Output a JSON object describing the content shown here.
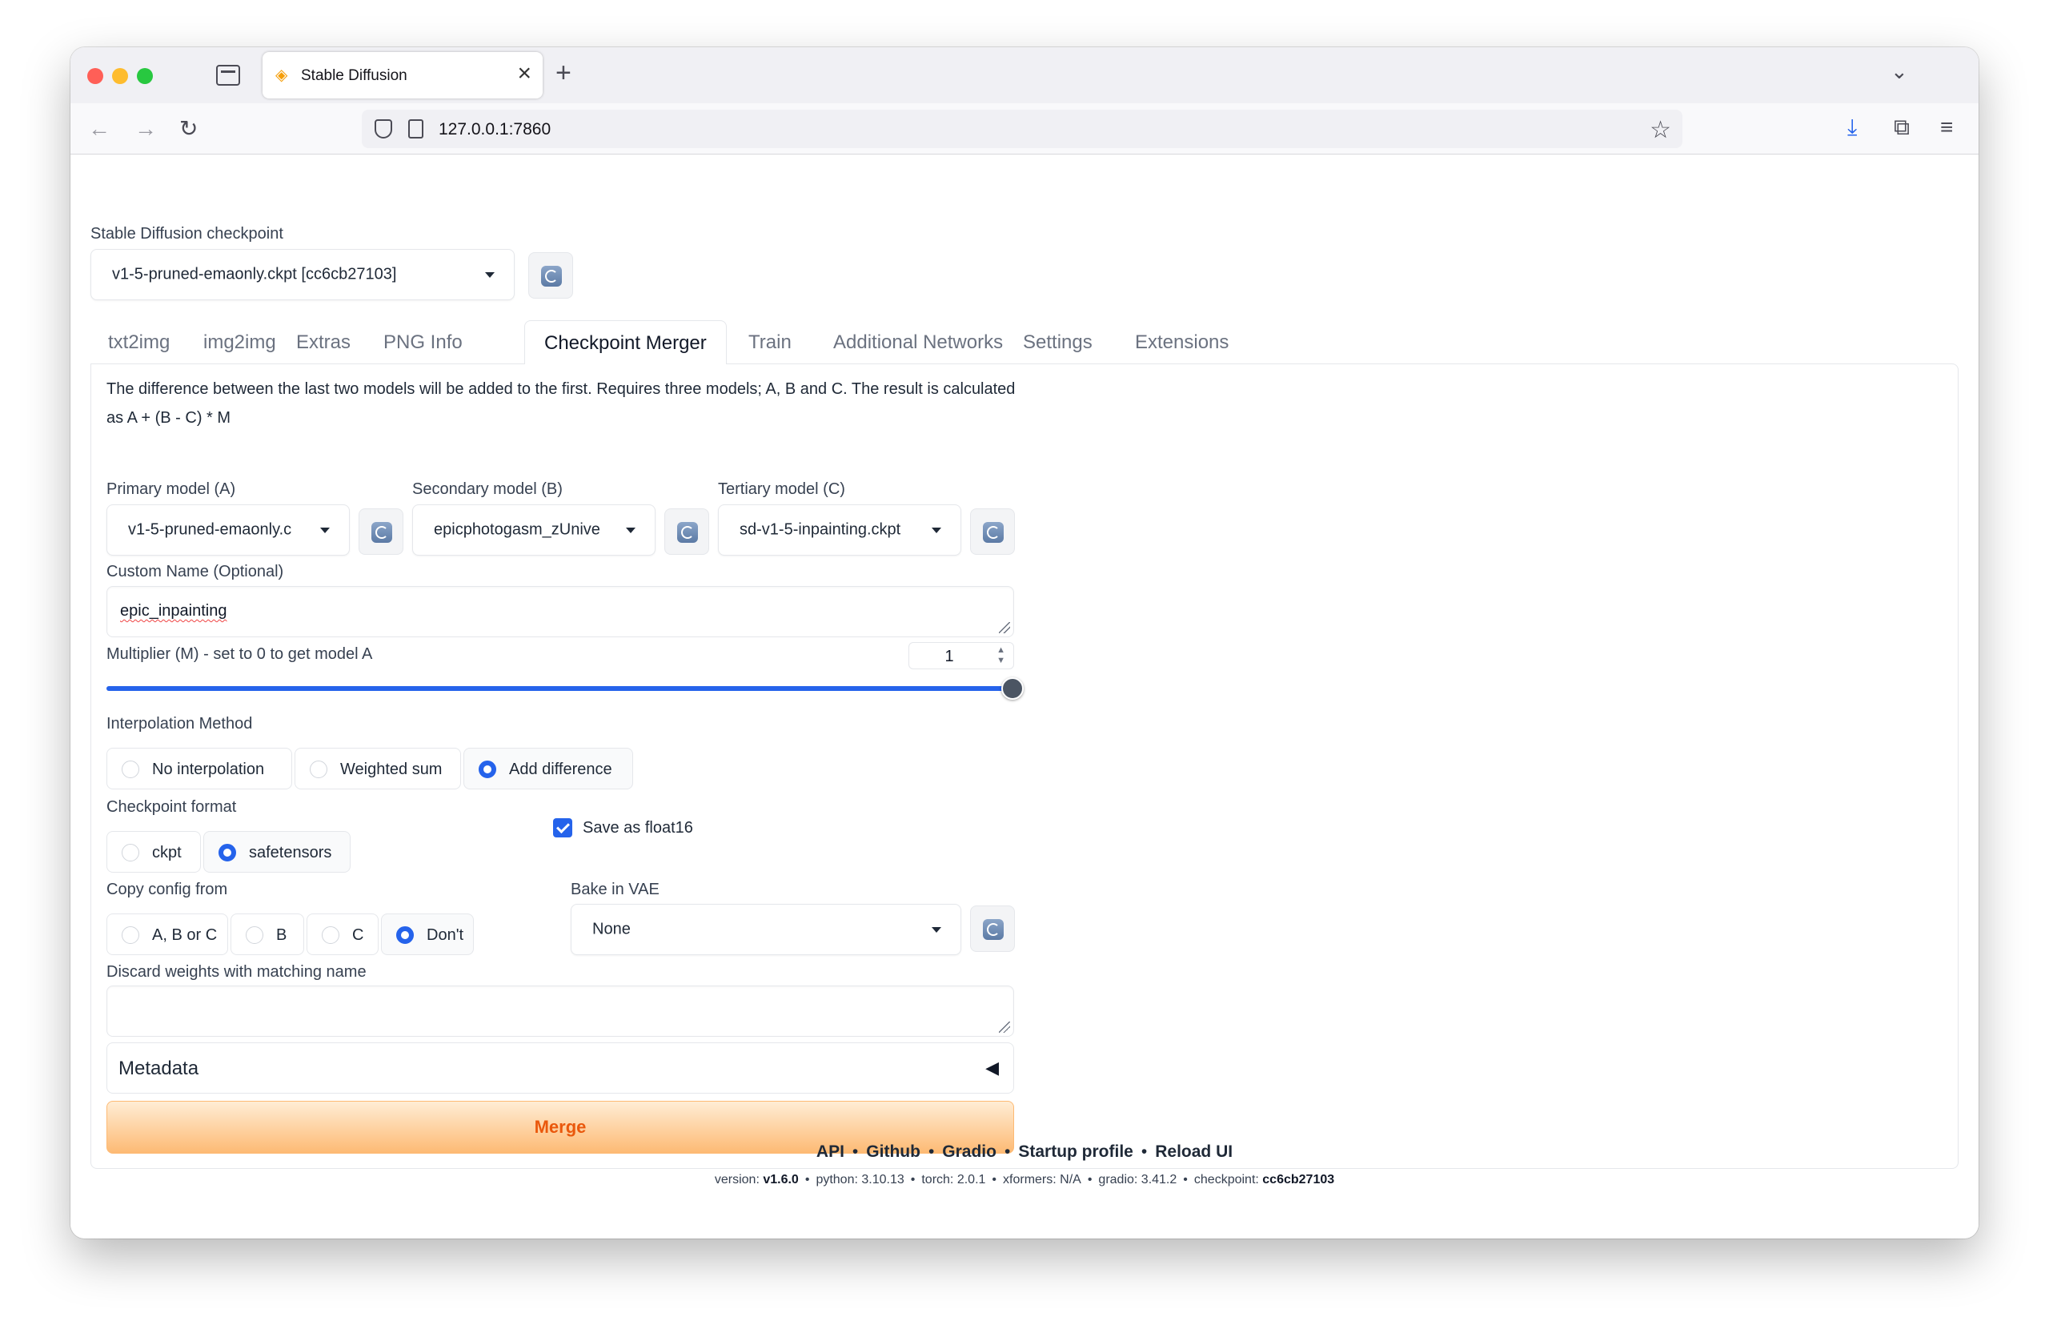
{
  "browser": {
    "tab_title": "Stable Diffusion",
    "url": "127.0.0.1:7860"
  },
  "checkpoint": {
    "label": "Stable Diffusion checkpoint",
    "value": "v1-5-pruned-emaonly.ckpt [cc6cb27103]"
  },
  "tabs": [
    "txt2img",
    "img2img",
    "Extras",
    "PNG Info",
    "Checkpoint Merger",
    "Train",
    "Additional Networks",
    "Settings",
    "Extensions"
  ],
  "active_tab": "Checkpoint Merger",
  "description": "The difference between the last two models will be added to the first. Requires three models; A, B and C. The result is calculated as A + (B - C) * M",
  "models": {
    "primary": {
      "label": "Primary model (A)",
      "value": "v1-5-pruned-emaonly.c"
    },
    "secondary": {
      "label": "Secondary model (B)",
      "value": "epicphotogasm_zUnive"
    },
    "tertiary": {
      "label": "Tertiary model (C)",
      "value": "sd-v1-5-inpainting.ckpt"
    }
  },
  "custom_name": {
    "label": "Custom Name (Optional)",
    "value": "epic_inpainting"
  },
  "multiplier": {
    "label": "Multiplier (M) - set to 0 to get model A",
    "value": "1",
    "fraction": 1.0
  },
  "interpolation": {
    "label": "Interpolation Method",
    "options": [
      "No interpolation",
      "Weighted sum",
      "Add difference"
    ],
    "selected": "Add difference"
  },
  "checkpoint_format": {
    "label": "Checkpoint format",
    "options": [
      "ckpt",
      "safetensors"
    ],
    "selected": "safetensors"
  },
  "save_float16": {
    "label": "Save as float16",
    "checked": true
  },
  "copy_config": {
    "label": "Copy config from",
    "options": [
      "A, B or C",
      "B",
      "C",
      "Don't"
    ],
    "selected": "Don't"
  },
  "bake_vae": {
    "label": "Bake in VAE",
    "value": "None"
  },
  "discard_weights": {
    "label": "Discard weights with matching name",
    "value": ""
  },
  "metadata": {
    "label": "Metadata",
    "arrow": "◀"
  },
  "merge_button": "Merge",
  "footer": {
    "links": [
      "API",
      "Github",
      "Gradio",
      "Startup profile",
      "Reload UI"
    ],
    "version_label": "version:",
    "version": "v1.6.0",
    "python": "python: 3.10.13",
    "torch": "torch: 2.0.1",
    "xformers": "xformers: N/A",
    "gradio": "gradio: 3.41.2",
    "checkpoint_label": "checkpoint:",
    "checkpoint": "cc6cb27103"
  }
}
